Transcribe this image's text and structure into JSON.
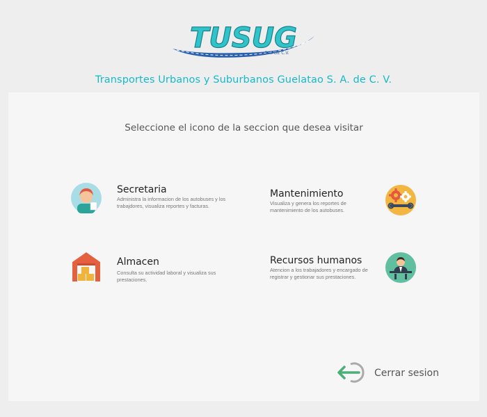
{
  "brand": {
    "logo_text": "TUSUG",
    "logo_tagline": "S.A. DE C.V.",
    "company_name": "Transportes  Urbanos y Suburbanos Guelatao S. A. de C. V."
  },
  "main": {
    "prompt": "Seleccione el icono de la seccion que desea visitar",
    "sections": {
      "secretaria": {
        "title": "Secretaria",
        "description": "Administra la informacion de los autobuses y los trabajdores, visualiza reportes y facturas.",
        "icon": "secretary-icon"
      },
      "mantenimiento": {
        "title": "Mantenimiento",
        "description": "Visualiza y genera los reportes de mantenimiento de los autobuses.",
        "icon": "gears-wrench-icon"
      },
      "almacen": {
        "title": "Almacen",
        "description": "Consulta su actividad laboral y visualiza sus prestaciones.",
        "icon": "warehouse-icon"
      },
      "recursos_humanos": {
        "title": "Recursos humanos",
        "description": "Atencion a los trabajadores y encargado de registrar y gestionar sus prestaciones.",
        "icon": "hr-manager-icon"
      }
    },
    "logout_label": "Cerrar sesion"
  },
  "colors": {
    "accent": "#17b9c9",
    "logo_teal": "#2fc4c9",
    "logo_blue": "#2a5fae",
    "logout_green": "#4caf7a"
  }
}
